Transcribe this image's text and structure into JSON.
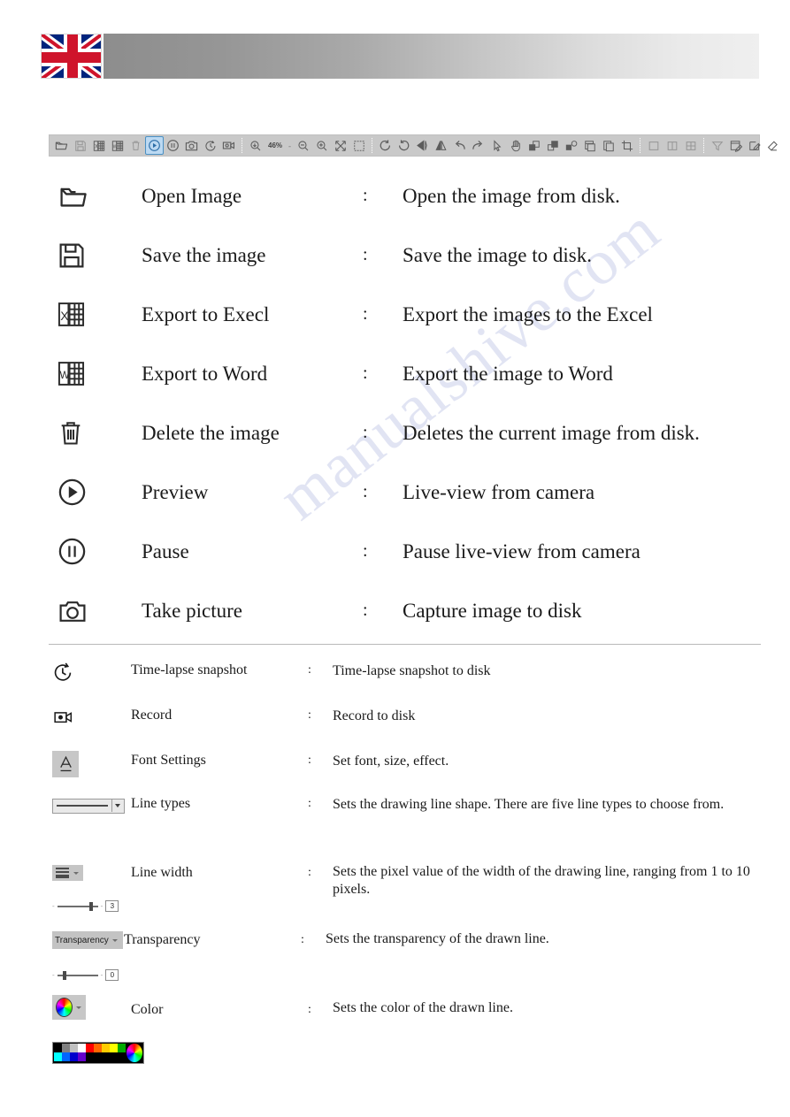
{
  "header": {
    "flag": "uk-flag",
    "gradient_from": "#8d8d8d",
    "gradient_to": "#efefef"
  },
  "watermark": {
    "text": "manualshive.com"
  },
  "toolbar": {
    "zoom_value": "46%",
    "separator": "-",
    "buttons": [
      {
        "name": "open-image",
        "icon": "folder-open-icon",
        "state": "enabled"
      },
      {
        "name": "save-image",
        "icon": "floppy-save-icon",
        "state": "disabled"
      },
      {
        "name": "export-excel",
        "icon": "excel-export-icon",
        "state": "enabled"
      },
      {
        "name": "export-word",
        "icon": "word-export-icon",
        "state": "enabled"
      },
      {
        "name": "delete-image",
        "icon": "trash-icon",
        "state": "disabled"
      },
      {
        "name": "preview",
        "icon": "play-circle-icon",
        "state": "active"
      },
      {
        "name": "pause",
        "icon": "pause-circle-icon",
        "state": "enabled"
      },
      {
        "name": "take-picture",
        "icon": "camera-icon",
        "state": "enabled"
      },
      {
        "name": "time-lapse-snapshot",
        "icon": "stopwatch-icon",
        "state": "enabled"
      },
      {
        "name": "record",
        "icon": "video-camera-icon",
        "state": "enabled"
      },
      {
        "name": "zoom-fit",
        "icon": "magnifier-fit-icon",
        "state": "enabled"
      },
      {
        "name": "zoom-out",
        "icon": "magnifier-minus-icon",
        "state": "enabled"
      },
      {
        "name": "zoom-in",
        "icon": "magnifier-plus-icon",
        "state": "enabled"
      },
      {
        "name": "fit-to-window",
        "icon": "expand-arrows-icon",
        "state": "enabled"
      },
      {
        "name": "select-region",
        "icon": "marquee-select-icon",
        "state": "enabled"
      },
      {
        "name": "rotate-left",
        "icon": "rotate-ccw-icon",
        "state": "enabled"
      },
      {
        "name": "rotate-right",
        "icon": "rotate-cw-icon",
        "state": "enabled"
      },
      {
        "name": "flip-horizontal",
        "icon": "flip-horizontal-icon",
        "state": "enabled"
      },
      {
        "name": "flip-vertical",
        "icon": "flip-vertical-icon",
        "state": "enabled"
      },
      {
        "name": "undo",
        "icon": "undo-arrow-icon",
        "state": "enabled"
      },
      {
        "name": "redo",
        "icon": "redo-arrow-icon",
        "state": "enabled"
      },
      {
        "name": "pointer-tool",
        "icon": "cursor-arrow-icon",
        "state": "enabled"
      },
      {
        "name": "pan-tool",
        "icon": "hand-icon",
        "state": "enabled"
      },
      {
        "name": "bring-forward",
        "icon": "bring-forward-icon",
        "state": "enabled"
      },
      {
        "name": "send-backward",
        "icon": "send-backward-icon",
        "state": "enabled"
      },
      {
        "name": "group-objects",
        "icon": "group-objects-icon",
        "state": "enabled"
      },
      {
        "name": "paste-layer",
        "icon": "paste-icon",
        "state": "enabled"
      },
      {
        "name": "copy-layer",
        "icon": "copy-icon",
        "state": "enabled"
      },
      {
        "name": "crop",
        "icon": "crop-icon",
        "state": "enabled"
      },
      {
        "name": "single-pane-view",
        "icon": "single-pane-icon",
        "state": "disabled"
      },
      {
        "name": "two-pane-view",
        "icon": "two-pane-icon",
        "state": "disabled"
      },
      {
        "name": "four-pane-view",
        "icon": "four-pane-icon",
        "state": "disabled"
      },
      {
        "name": "filter",
        "icon": "funnel-icon",
        "state": "disabled"
      },
      {
        "name": "annotate",
        "icon": "note-edit-icon",
        "state": "enabled"
      },
      {
        "name": "pencil",
        "icon": "pencil-square-icon",
        "state": "enabled"
      },
      {
        "name": "eraser",
        "icon": "eraser-icon",
        "state": "enabled"
      }
    ]
  },
  "legend": {
    "colon": ":",
    "primary_rows": [
      {
        "icon": "folder-open-icon",
        "name": "Open Image",
        "description": "Open the image from disk."
      },
      {
        "icon": "floppy-save-icon",
        "name": "Save the image",
        "description": "Save the image to disk."
      },
      {
        "icon": "excel-export-icon",
        "name": "Export to Execl",
        "description": "Export the images to the Excel"
      },
      {
        "icon": "word-export-icon",
        "name": "Export to Word",
        "description": "Export the image to Word"
      },
      {
        "icon": "trash-icon",
        "name": "Delete the image",
        "description": "Deletes the current image from disk."
      },
      {
        "icon": "play-circle-icon",
        "name": "Preview",
        "description": "Live-view from camera"
      },
      {
        "icon": "pause-circle-icon",
        "name": "Pause",
        "description": "Pause live-view from camera"
      },
      {
        "icon": "camera-icon",
        "name": "Take picture",
        "description": "Capture image to disk"
      }
    ],
    "secondary_rows": [
      {
        "icon": "stopwatch-icon",
        "name": "Time-lapse snapshot",
        "description": "Time-lapse snapshot to disk"
      },
      {
        "icon": "video-camera-icon",
        "name": "Record",
        "description": "Record to disk"
      },
      {
        "icon": "font-settings-icon",
        "name": "Font Settings",
        "description": "Set font, size, effect."
      },
      {
        "icon": "line-type-combo",
        "name": "Line types",
        "description": "Sets the drawing line shape. There are five line types to choose from."
      },
      {
        "icon": "line-width-icon",
        "name": "Line width",
        "description": "Sets the pixel value of the width of the drawing line, ranging from 1 to 10 pixels."
      },
      {
        "icon": "transparency-combo",
        "name": "Transparency",
        "description": "Sets the transparency of the drawn line."
      },
      {
        "icon": "color-wheel-icon",
        "name": "Color",
        "description": "Sets the color of the drawn line."
      }
    ]
  },
  "widgets": {
    "line_width_slider": {
      "value": "3",
      "min_tick": "-",
      "max_tick": "-"
    },
    "transparency_label": "Transparency",
    "transparency_slider": {
      "value": "0"
    },
    "palette": {
      "row1": [
        "#000000",
        "#808080",
        "#c0c0c0",
        "#ffffff",
        "#ff0000",
        "#ff6600",
        "#ffcc00",
        "#ffff00",
        "#00aa00"
      ],
      "row2": [
        "#00ffff",
        "#0066ff",
        "#0000cc",
        "#6600cc",
        "#000000",
        "#000000",
        "#000000",
        "#000000",
        "#000000"
      ],
      "wheel": "color-wheel-icon"
    }
  }
}
